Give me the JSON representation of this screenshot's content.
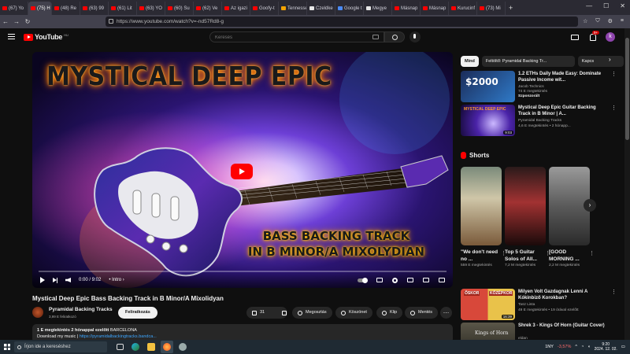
{
  "browser": {
    "tabs": [
      {
        "label": "(67) Yo",
        "fav": "yt"
      },
      {
        "label": "(75) H",
        "fav": "yt",
        "active": true
      },
      {
        "label": "(48) Re",
        "fav": "yt"
      },
      {
        "label": "(63) 99",
        "fav": "yt"
      },
      {
        "label": "(61) Lit",
        "fav": "yt"
      },
      {
        "label": "(63) YO",
        "fav": "yt"
      },
      {
        "label": "(60) Su",
        "fav": "yt"
      },
      {
        "label": "(62) Ve",
        "fav": "yt"
      },
      {
        "label": "Az igazi",
        "fav": "yt"
      },
      {
        "label": "Goofy-t",
        "fav": "yt"
      },
      {
        "label": "Tennesse",
        "fav": "o"
      },
      {
        "label": "Czeldke",
        "fav": "w"
      },
      {
        "label": "Google t",
        "fav": "b"
      },
      {
        "label": "Megye",
        "fav": "w"
      },
      {
        "label": "Másnap",
        "fav": "yt"
      },
      {
        "label": "Másnap",
        "fav": "yt"
      },
      {
        "label": "Kurucinf",
        "fav": "yt"
      },
      {
        "label": "(73) Mi",
        "fav": "yt"
      }
    ],
    "url": "https://www.youtube.com/watch?v=-nd57Rd8-g"
  },
  "yt": {
    "logo_text": "YouTube",
    "region": "HU",
    "search_placeholder": "Keresés",
    "notif_count": "9+",
    "avatar_letter": "k"
  },
  "player": {
    "overlay_title": "MYSTICAL DEEP EPIC",
    "overlay_sub1": "BASS BACKING TRACK",
    "overlay_sub2": "IN B MINOR/A MIXOLYDIAN",
    "time": "0:00 / 9:02",
    "chapter": "• Intro ›",
    "progress": 0
  },
  "video": {
    "title": "Mystical Deep Epic Bass Backing Track in B Minor/A Mixolidyan",
    "channel": "Pyramidal Backing Tracks",
    "subs": "3,99 E feliratkozó",
    "subscribe": "Feliratkozás",
    "likes": "31",
    "share": "Megosztás",
    "thanks": "Köszönet",
    "clip": "Klip",
    "save": "Mentés",
    "desc_meta": "1 E megtekintés  2 hónappal ezelőtt",
    "desc_tag": "BARCELONA",
    "desc_line": "Download my music | ",
    "desc_link": "https://pyramidalbackingtracks.bandca..."
  },
  "sidebar": {
    "chips": [
      "Mind",
      "Feltöltő: Pyramidal Backing Tr...",
      "Kapcs"
    ],
    "recs": [
      {
        "title": "1.2 ETHs Daily Made Easy: Dominate Passive Income wit...",
        "channel": "Jacob Technics",
        "meta": "74 E megtekintés",
        "sponsored": "Szponzorált",
        "thumb_text": "$2000"
      },
      {
        "title": "Mystical Deep Epic Guitar Backing Track in B Minor | A...",
        "channel": "Pyramidal Backing Tracks",
        "meta": "4,6 E megtekintés • 2 hónapp...",
        "duration": "9:03"
      }
    ],
    "shorts_title": "Shorts",
    "shorts": [
      {
        "title": "\"We don't need no ...",
        "views": "559 E megtekintés"
      },
      {
        "title": "Top 5 Guitar Solos of All...",
        "views": "7,2 M megtekintés"
      },
      {
        "title": "[GOOD MORNING ...",
        "views": "2,2 M megtekintés"
      }
    ],
    "more_recs": [
      {
        "title": "Milyen Volt Gazdagnak Lenni A Kókinbiző Korokban?",
        "channel": "Tasz Lista",
        "meta": "49 E megtekintés • 19 órával ezelőtt",
        "new_badge": "Új",
        "duration": "16:39",
        "thumb_left": "ŐSKOR",
        "thumb_right": "KŐZÉPKOR"
      },
      {
        "title": "Shrek 3 - Kings Of Horn (Guitar Cover)",
        "channel": "eldan",
        "thumb_text": "Kings of Horn"
      }
    ]
  },
  "taskbar": {
    "search_placeholder": "Írjon ide a kereséshez",
    "stock": "1NY",
    "stock_change": "-3,57%",
    "time": "9:20",
    "date": "2024. 12. 02."
  },
  "colors": {
    "accent": "#ff0000",
    "bg": "#0f0f0f",
    "link": "#3ea6ff"
  }
}
